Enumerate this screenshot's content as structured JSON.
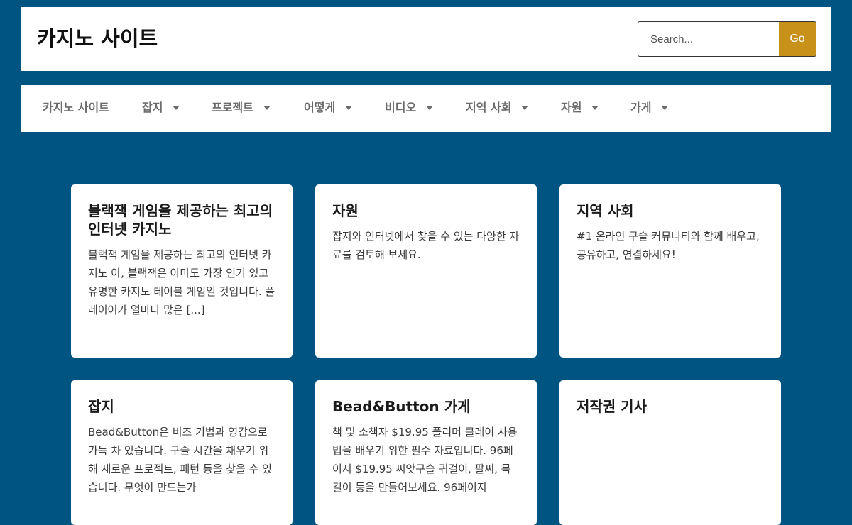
{
  "header": {
    "site_title": "카지노 사이트",
    "search": {
      "placeholder": "Search...",
      "value": "",
      "button_label": "Go"
    }
  },
  "nav": {
    "items": [
      {
        "label": "카지노 사이트",
        "has_dropdown": false
      },
      {
        "label": "잡지",
        "has_dropdown": true
      },
      {
        "label": "프로젝트",
        "has_dropdown": true
      },
      {
        "label": "어떻게",
        "has_dropdown": true
      },
      {
        "label": "비디오",
        "has_dropdown": true
      },
      {
        "label": "지역 사회",
        "has_dropdown": true
      },
      {
        "label": "자원",
        "has_dropdown": true
      },
      {
        "label": "가게",
        "has_dropdown": true
      }
    ]
  },
  "cards": [
    {
      "title": "블랙잭 게임을 제공하는 최고의 인터넷 카지노",
      "text": "블랙잭 게임을 제공하는 최고의 인터넷 카지노 아, 블랙잭은 아마도 가장 인기 있고 유명한 카지노 테이블 게임일 것입니다. 플레이어가 얼마나 많은 [...]"
    },
    {
      "title": "자원",
      "text": "잡지와 인터넷에서 찾을 수 있는 다양한 자료를 검토해 보세요."
    },
    {
      "title": "지역 사회",
      "text": "#1 온라인 구슬 커뮤니티와 함께 배우고, 공유하고, 연결하세요!"
    },
    {
      "title": "잡지",
      "text": "Bead&Button은 비즈 기법과 영감으로 가득 차 있습니다. 구슬 시간을 채우기 위해 새로운 프로젝트, 패턴 등을 찾을 수 있습니다. 무엇이 만드는가"
    },
    {
      "title": "Bead&Button 가게",
      "text": "책 및 소책자 $19.95 폴리머 클레이 사용법을 배우기 위한 필수 자료입니다. 96페이지 $19.95 씨앗구슬 귀걸이, 팔찌, 목걸이 등을 만들어보세요. 96페이지"
    },
    {
      "title": "저작권 기사",
      "text": ""
    }
  ],
  "colors": {
    "background": "#005481",
    "accent": "#c8921a",
    "nav_text": "#6b6b6b"
  }
}
